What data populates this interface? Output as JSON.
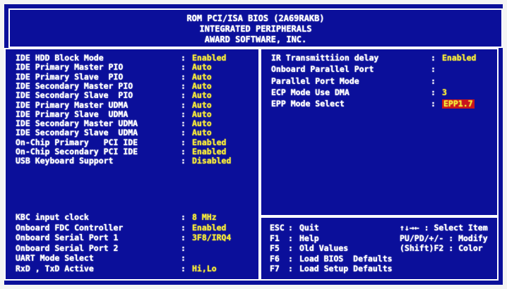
{
  "header": {
    "line1": "ROM PCI/ISA BIOS (2A69RAKB)",
    "line2": "INTEGRATED PERIPHERALS",
    "line3": "AWARD SOFTWARE, INC."
  },
  "left_settings": [
    {
      "label": "IDE HDD Block Mode",
      "value": "Enabled"
    },
    {
      "label": "IDE Primary Master PIO",
      "value": "Auto"
    },
    {
      "label": "IDE Primary Slave  PIO",
      "value": "Auto"
    },
    {
      "label": "IDE Secondary Master PIO",
      "value": "Auto"
    },
    {
      "label": "IDE Secondary Slave  PIO",
      "value": "Auto"
    },
    {
      "label": "IDE Primary Master UDMA",
      "value": "Auto"
    },
    {
      "label": "IDE Primary Slave  UDMA",
      "value": "Auto"
    },
    {
      "label": "IDE Secondary Master UDMA",
      "value": "Auto"
    },
    {
      "label": "IDE Secondary Slave  UDMA",
      "value": "Auto"
    },
    {
      "label": "On-Chip Primary   PCI IDE",
      "value": "Enabled"
    },
    {
      "label": "On-Chip Secondary PCI IDE",
      "value": "Enabled"
    },
    {
      "label": "USB Keyboard Support",
      "value": "Disabled"
    }
  ],
  "left_settings_2": [
    {
      "label": "KBC input clock",
      "value": "8 MHz"
    },
    {
      "label": "Onboard FDC Controller",
      "value": "Enabled"
    },
    {
      "label": "Onboard Serial Port 1",
      "value": "3F8/IRQ4"
    },
    {
      "label": "Onboard Serial Port 2",
      "value": ""
    },
    {
      "label": "UART Mode Select",
      "value": ""
    },
    {
      "label": "RxD , TxD Active",
      "value": "Hi,Lo"
    }
  ],
  "right_settings": [
    {
      "label": "IR Transmittiion delay",
      "value": "Enabled"
    },
    {
      "label": "Onboard Parallel Port",
      "value": ""
    },
    {
      "label": "Parallel Port Mode",
      "value": ""
    },
    {
      "label": "ECP Mode Use DMA",
      "value": "3"
    },
    {
      "label": "EPP Mode Select",
      "value": "EPP1.7"
    }
  ],
  "colon": ":",
  "help_left": [
    {
      "key": "ESC",
      "desc": "Quit"
    },
    {
      "key": "F1",
      "desc": "Help"
    },
    {
      "key": "F5",
      "desc": "Old Values"
    },
    {
      "key": "F6",
      "desc": "Load BIOS  Defaults"
    },
    {
      "key": "F7",
      "desc": "Load Setup Defaults"
    }
  ],
  "help_right": [
    "↑↓→← : Select Item",
    "PU/PD/+/- : Modify",
    "(Shift)F2 : Color"
  ],
  "colors": {
    "background": "#0b0f9a",
    "text": "#ffffff",
    "value": "#f4e83a",
    "highlight": "#c8141e"
  }
}
